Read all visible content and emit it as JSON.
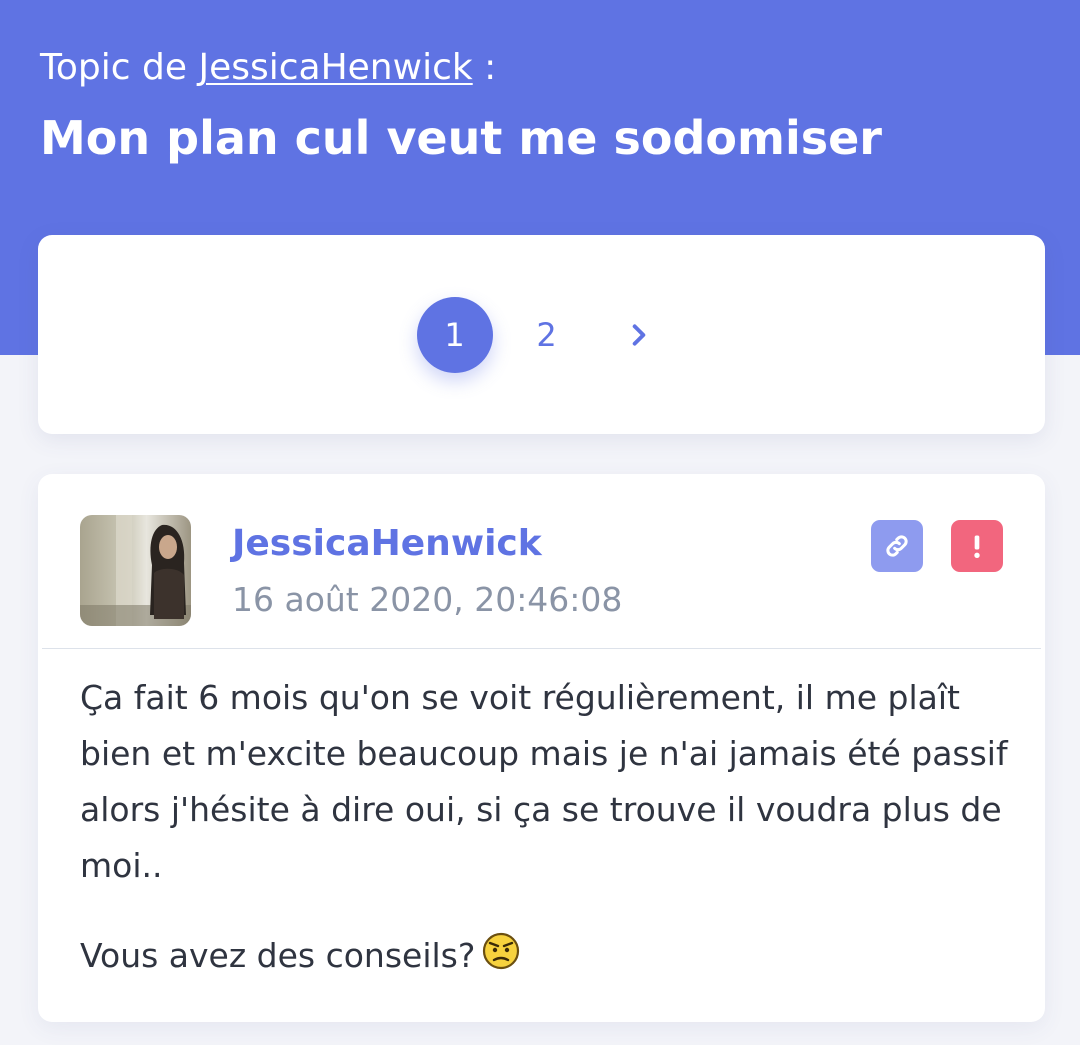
{
  "header": {
    "topic_prefix": "Topic de",
    "topic_author": "JessicaHenwick",
    "topic_suffix": ":",
    "title": "Mon plan cul veut me sodomiser"
  },
  "pagination": {
    "pages": [
      "1",
      "2"
    ],
    "current_page": "1",
    "next_icon": "chevron-right-icon"
  },
  "post": {
    "author": "JessicaHenwick",
    "date": "16 août 2020, 20:46:08",
    "avatar_icon": "user-photo",
    "link_icon": "link-icon",
    "report_icon": "exclamation-icon",
    "paragraph_1": "Ça fait 6 mois qu'on se voit régulièrement, il me plaît bien et m'excite beaucoup mais je n'ai jamais été passif alors j'hésite à dire oui, si ça se trouve il voudra plus de moi..",
    "paragraph_2": "Vous avez des conseils?",
    "emoji_icon": "worried-emoji-icon"
  },
  "colors": {
    "accent": "#5f73e3",
    "link_button": "#8e9bef",
    "report_button": "#f2667e",
    "date_text": "#8a94a6",
    "body_text": "#2f3440"
  }
}
